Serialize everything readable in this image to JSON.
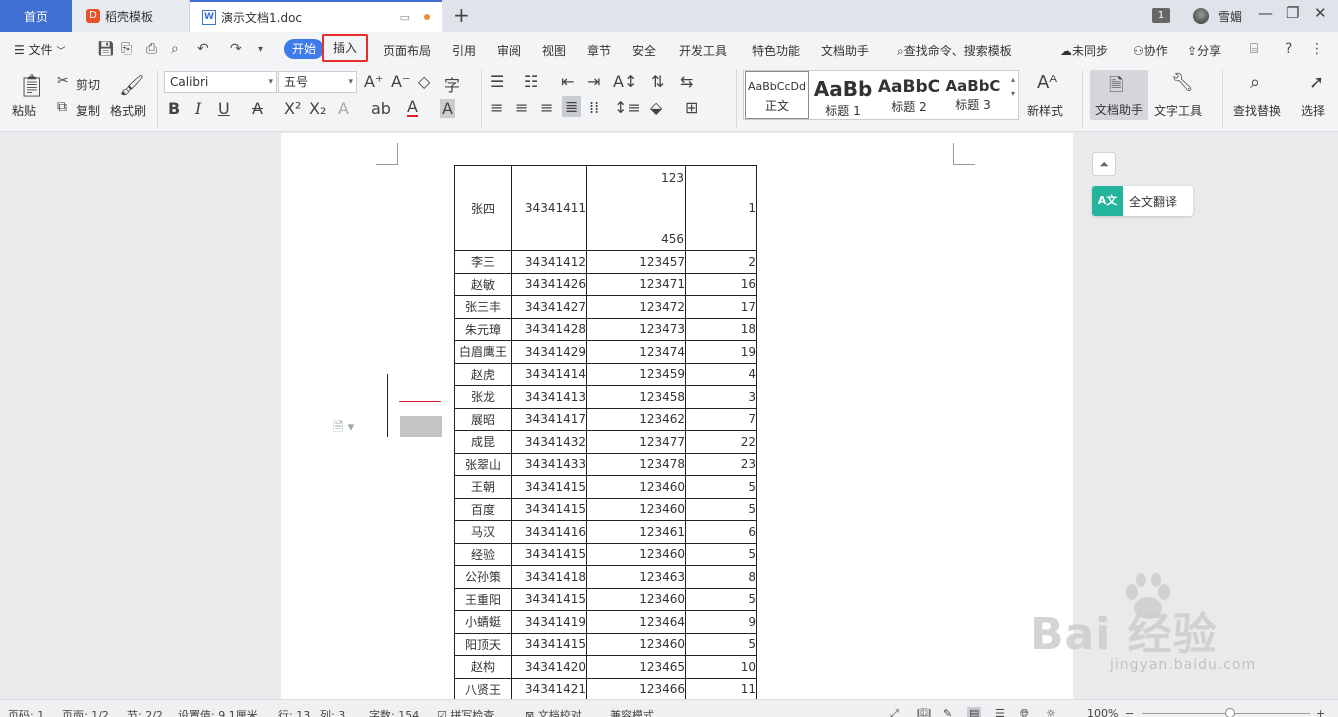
{
  "tabs": {
    "home": "首页",
    "template": "稻壳模板",
    "document": "演示文档1.doc",
    "new_tab": "+"
  },
  "window": {
    "badge": "1",
    "user": "雪媚",
    "minimize": "—",
    "restore": "❐",
    "close": "✕"
  },
  "menu": {
    "file": "文件",
    "start": "开始",
    "insert": "插入",
    "layout": "页面布局",
    "reference": "引用",
    "review": "审阅",
    "view": "视图",
    "chapter": "章节",
    "security": "安全",
    "devtools": "开发工具",
    "special": "特色功能",
    "assistant": "文档助手",
    "search": "查找命令、搜索模板",
    "unsynced": "未同步",
    "collab": "协作",
    "share": "分享"
  },
  "ribbon": {
    "paste": "粘贴",
    "cut": "剪切",
    "copy": "复制",
    "format_painter": "格式刷",
    "font_name": "Calibri",
    "font_size": "五号",
    "styles": [
      {
        "preview": "AaBbCcDd",
        "label": "正文"
      },
      {
        "preview": "AaBb",
        "label": "标题 1"
      },
      {
        "preview": "AaBbC",
        "label": "标题 2"
      },
      {
        "preview": "AaBbC",
        "label": "标题 3"
      }
    ],
    "new_style": "新样式",
    "doc_assistant": "文档助手",
    "text_tools": "文字工具",
    "find_replace": "查找替换",
    "select": "选择"
  },
  "side": {
    "translate": "全文翻译"
  },
  "table": {
    "first_row": {
      "name": "张四",
      "id": "34341411",
      "top": "123",
      "bottom": "456",
      "n": "1"
    },
    "rows": [
      [
        "李三",
        "34341412",
        "123457",
        "2"
      ],
      [
        "赵敏",
        "34341426",
        "123471",
        "16"
      ],
      [
        "张三丰",
        "34341427",
        "123472",
        "17"
      ],
      [
        "朱元璋",
        "34341428",
        "123473",
        "18"
      ],
      [
        "白眉鹰王",
        "34341429",
        "123474",
        "19"
      ],
      [
        "赵虎",
        "34341414",
        "123459",
        "4"
      ],
      [
        "张龙",
        "34341413",
        "123458",
        "3"
      ],
      [
        "展昭",
        "34341417",
        "123462",
        "7"
      ],
      [
        "成昆",
        "34341432",
        "123477",
        "22"
      ],
      [
        "张翠山",
        "34341433",
        "123478",
        "23"
      ],
      [
        "王朝",
        "34341415",
        "123460",
        "5"
      ],
      [
        "百度",
        "34341415",
        "123460",
        "5"
      ],
      [
        "马汉",
        "34341416",
        "123461",
        "6"
      ],
      [
        "经验",
        "34341415",
        "123460",
        "5"
      ],
      [
        "公孙策",
        "34341418",
        "123463",
        "8"
      ],
      [
        "王重阳",
        "34341415",
        "123460",
        "5"
      ],
      [
        "小蜻蜓",
        "34341419",
        "123464",
        "9"
      ],
      [
        "阳顶天",
        "34341415",
        "123460",
        "5"
      ],
      [
        "赵构",
        "34341420",
        "123465",
        "10"
      ],
      [
        "八贤王",
        "34341421",
        "123466",
        "11"
      ]
    ]
  },
  "status": {
    "page_no": "页码: 1",
    "pages": "页面: 1/2",
    "section": "节: 2/2",
    "setting": "设置值: 9.1厘米",
    "row": "行: 13",
    "col": "列: 3",
    "words": "字数: 154",
    "spell": "拼写检查",
    "proof": "文档校对",
    "compat": "兼容模式",
    "zoom": "100%"
  },
  "watermark": {
    "brand": "Bai 经验",
    "url": "jingyan.baidu.com"
  }
}
